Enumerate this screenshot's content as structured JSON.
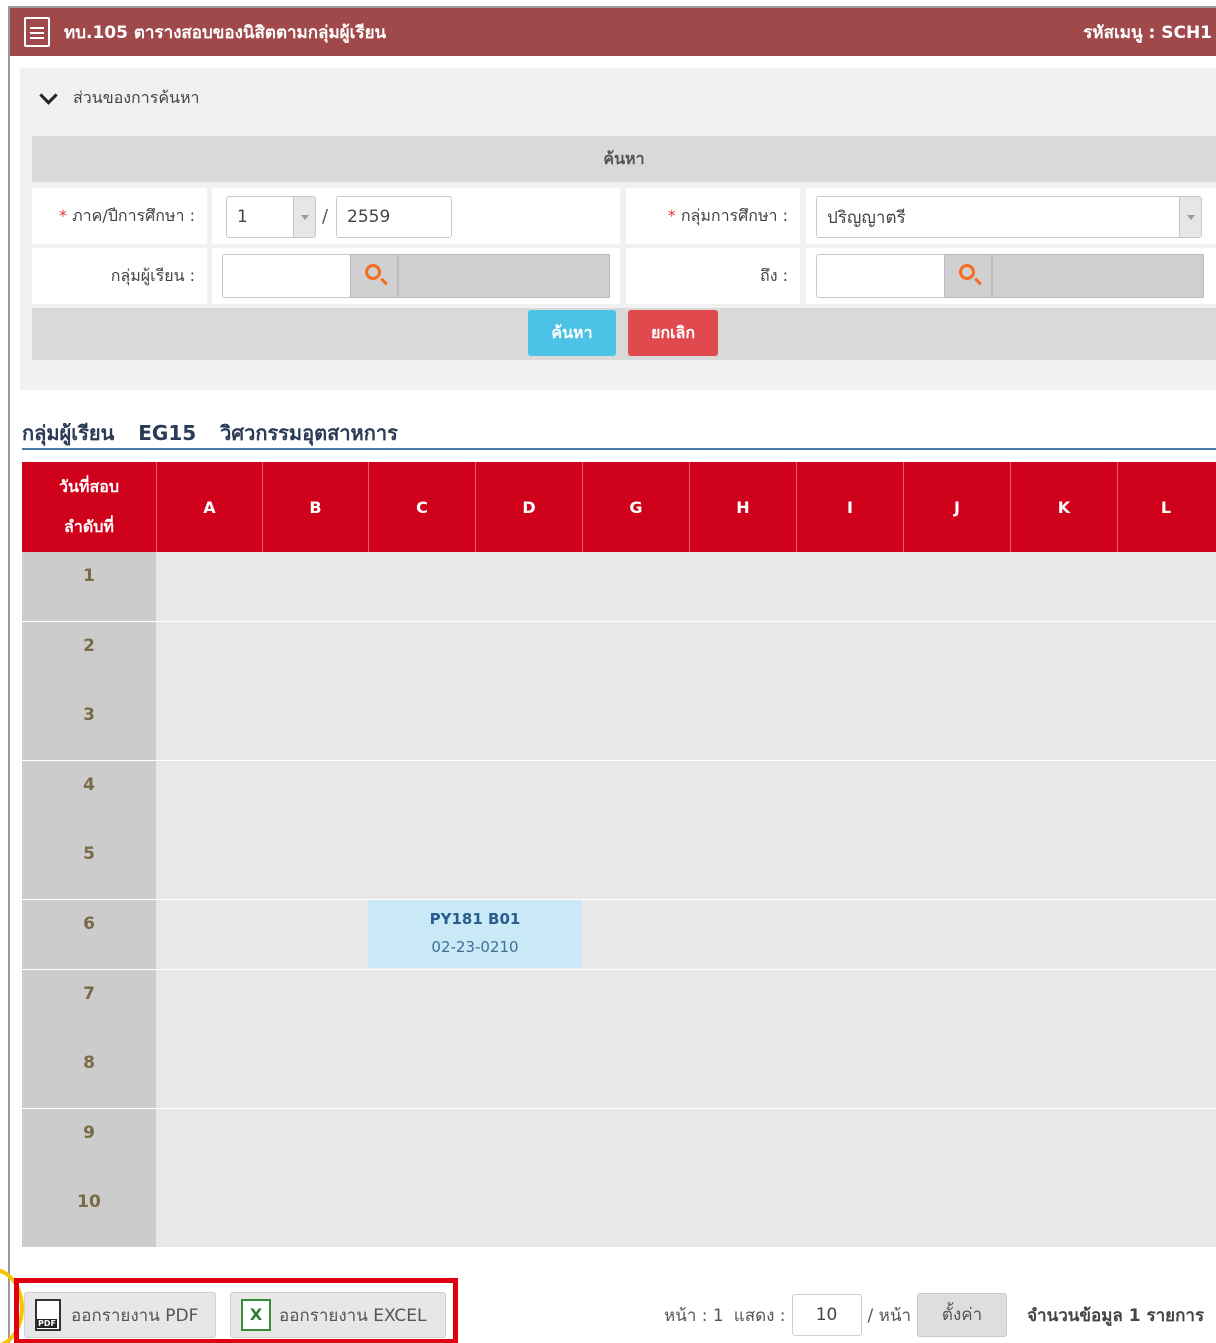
{
  "header": {
    "title": "ทบ.105 ตารางสอบของนิสิตตามกลุ่มผู้เรียน",
    "menu_code": "รหัสเมนู : SCH1"
  },
  "search": {
    "section_label": "ส่วนของการค้นหา",
    "heading": "ค้นหา",
    "semester_label": "ภาค/ปีการศึกษา :",
    "semester_value": "1",
    "separator": "/",
    "year_value": "2559",
    "study_group_label": "กลุ่มการศึกษา :",
    "study_group_value": "ปริญญาตรี",
    "learner_group_label": "กลุ่มผู้เรียน :",
    "to_label": "ถึง :",
    "required_mark": "*",
    "search_button": "ค้นหา",
    "cancel_button": "ยกเลิก"
  },
  "group": {
    "label": "กลุ่มผู้เรียน",
    "code": "EG15",
    "name": "วิศวกรรมอุตสาหการ"
  },
  "table": {
    "first_header_line1": "วันที่สอบ",
    "first_header_line2": "ลำดับที่",
    "columns": [
      "A",
      "B",
      "C",
      "D",
      "G",
      "H",
      "I",
      "J",
      "K",
      "L"
    ],
    "rows": [
      "1",
      "2",
      "3",
      "4",
      "5",
      "6",
      "7",
      "8",
      "9",
      "10"
    ],
    "exam": {
      "row": "6",
      "columns": [
        "C",
        "D"
      ],
      "course": "PY181 B01",
      "room": "02-23-0210"
    }
  },
  "footer": {
    "pdf_button": "ออกรายงาน PDF",
    "excel_button": "ออกรายงาน EXCEL",
    "page_label": "หน้า : 1",
    "show_label": "แสดง :",
    "per_page_value": "10",
    "per_page_suffix": "/ หน้า",
    "set_button": "ตั้งค่า",
    "total_label": "จำนวนข้อมูล 1 รายการ"
  }
}
